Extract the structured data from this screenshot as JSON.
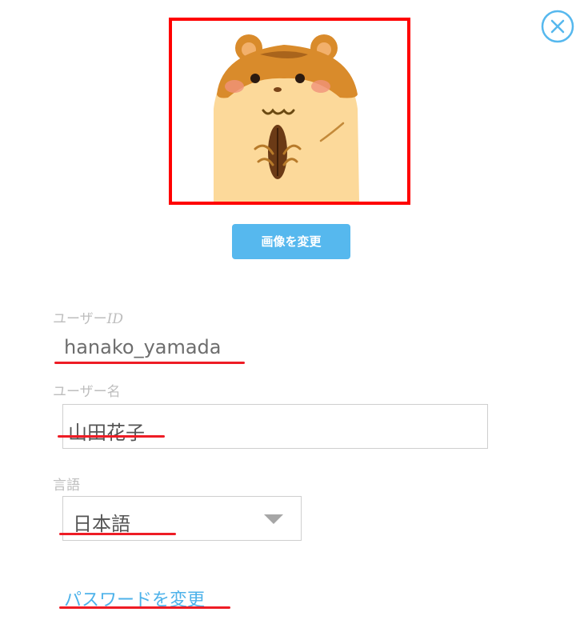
{
  "dialog": {
    "close_icon": "close-circle-icon",
    "avatar_image": "hamster-illustration",
    "change_image_label": "画像を変更",
    "user_id": {
      "label_prefix": "ユーザー",
      "label_suffix": "ID",
      "value": "hanako_yamada"
    },
    "user_name": {
      "label": "ユーザー名",
      "value": "山田花子"
    },
    "language": {
      "label": "言語",
      "selected": "日本語"
    },
    "change_password_label": "パスワードを変更"
  },
  "colors": {
    "accent": "#56b8ee",
    "link": "#4db2ea",
    "highlight_red": "#ee1c25",
    "frame_red": "#ff0000",
    "label_gray": "#bdbdbd"
  }
}
